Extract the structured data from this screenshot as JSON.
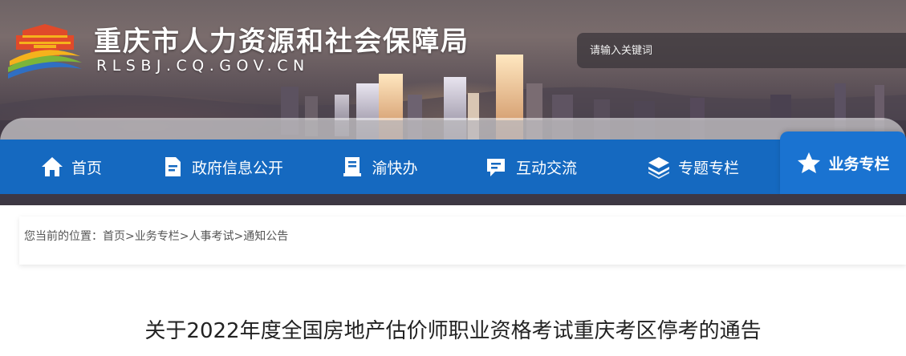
{
  "header": {
    "site_name": "重庆市人力资源和社会保障局",
    "site_domain": "RLSBJ.CQ.GOV.CN",
    "search_placeholder": "请输入关键词"
  },
  "nav": {
    "items": [
      {
        "label": "首页",
        "icon": "home-icon"
      },
      {
        "label": "政府信息公开",
        "icon": "document-icon"
      },
      {
        "label": "渝快办",
        "icon": "book-icon"
      },
      {
        "label": "互动交流",
        "icon": "chat-icon"
      },
      {
        "label": "专题专栏",
        "icon": "layers-icon"
      },
      {
        "label": "业务专栏",
        "icon": "star-icon",
        "active": true
      }
    ]
  },
  "breadcrumb": {
    "prefix": "您当前的位置：",
    "items": [
      "首页",
      "业务专栏",
      "人事考试",
      "通知公告"
    ],
    "separator": ">"
  },
  "article": {
    "title": "关于2022年度全国房地产估价师职业资格考试重庆考区停考的通告"
  },
  "colors": {
    "nav_bg": "#1569c0",
    "nav_active_bg": "#1a73d1",
    "logo_red": "#e04a2a",
    "logo_yellow": "#f5b21c",
    "logo_blue": "#2f6fc3",
    "logo_green": "#7bb53a"
  }
}
